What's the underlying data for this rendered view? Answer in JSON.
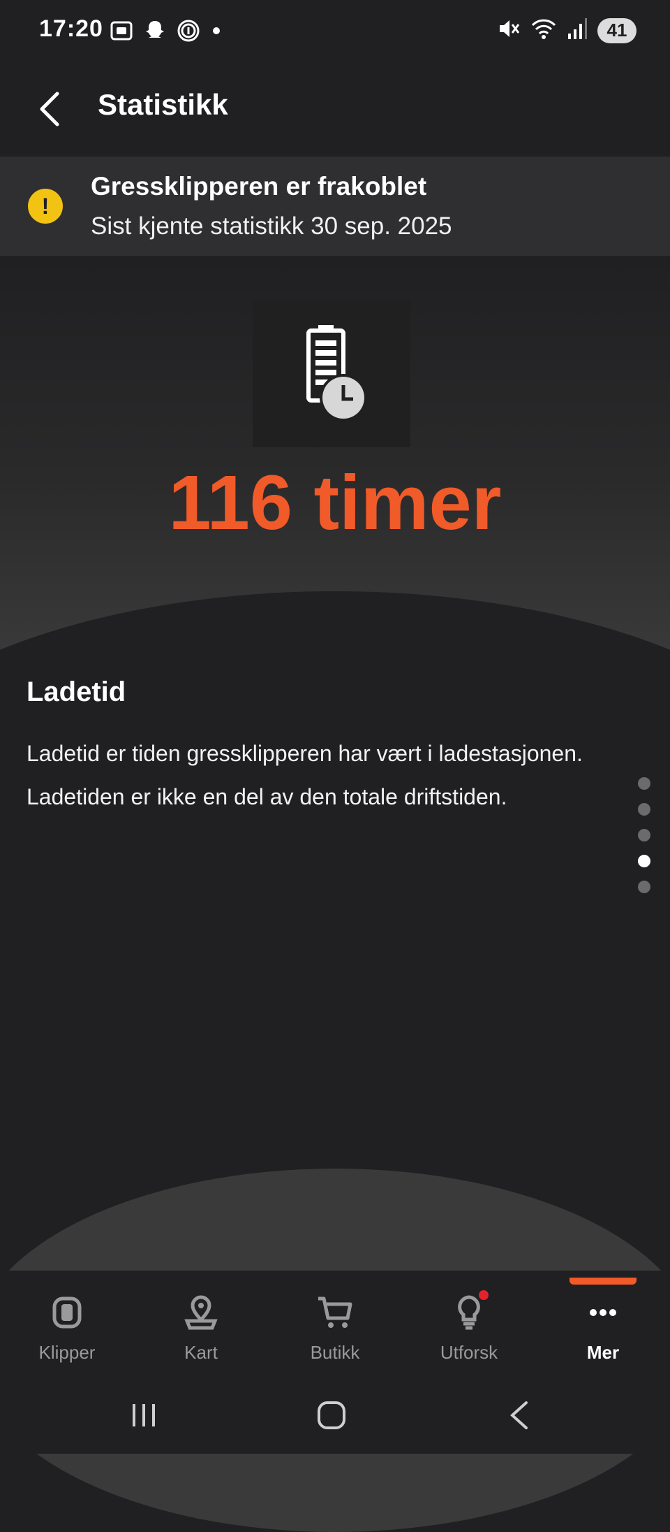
{
  "status_bar": {
    "time": "17:20",
    "battery": "41",
    "left_icons": [
      "screenshot-icon",
      "snapchat-icon",
      "fingerprint-icon",
      "dot-icon"
    ],
    "right_icons": [
      "mute-icon",
      "wifi-icon",
      "signal-icon"
    ]
  },
  "header": {
    "title": "Statistikk"
  },
  "banner": {
    "icon": "warning-icon",
    "icon_glyph": "!",
    "title": "Gressklipperen er frakoblet",
    "subtitle": "Sist kjente statistikk 30 sep. 2025"
  },
  "hero": {
    "icon": "battery-clock-icon",
    "value": "116 timer",
    "value_color": "#f15a29"
  },
  "section": {
    "title": "Ladetid",
    "paragraph_1": "Ladetid er tiden gressklipperen har vært i ladestasjonen.",
    "paragraph_2": "Ladetiden er ikke en del av den totale driftstiden."
  },
  "pager": {
    "total": 5,
    "active_index": 3
  },
  "bottom_nav": {
    "items": [
      {
        "label": "Klipper",
        "icon": "mower-icon"
      },
      {
        "label": "Kart",
        "icon": "map-pin-icon"
      },
      {
        "label": "Butikk",
        "icon": "cart-icon"
      },
      {
        "label": "Utforsk",
        "icon": "lightbulb-icon",
        "badge": true
      },
      {
        "label": "Mer",
        "icon": "more-icon",
        "active": true
      }
    ]
  },
  "colors": {
    "accent": "#f15a29",
    "warning": "#f3c313",
    "background": "#201f21",
    "banner_bg": "#2f2f31",
    "badge": "#e4222b"
  }
}
